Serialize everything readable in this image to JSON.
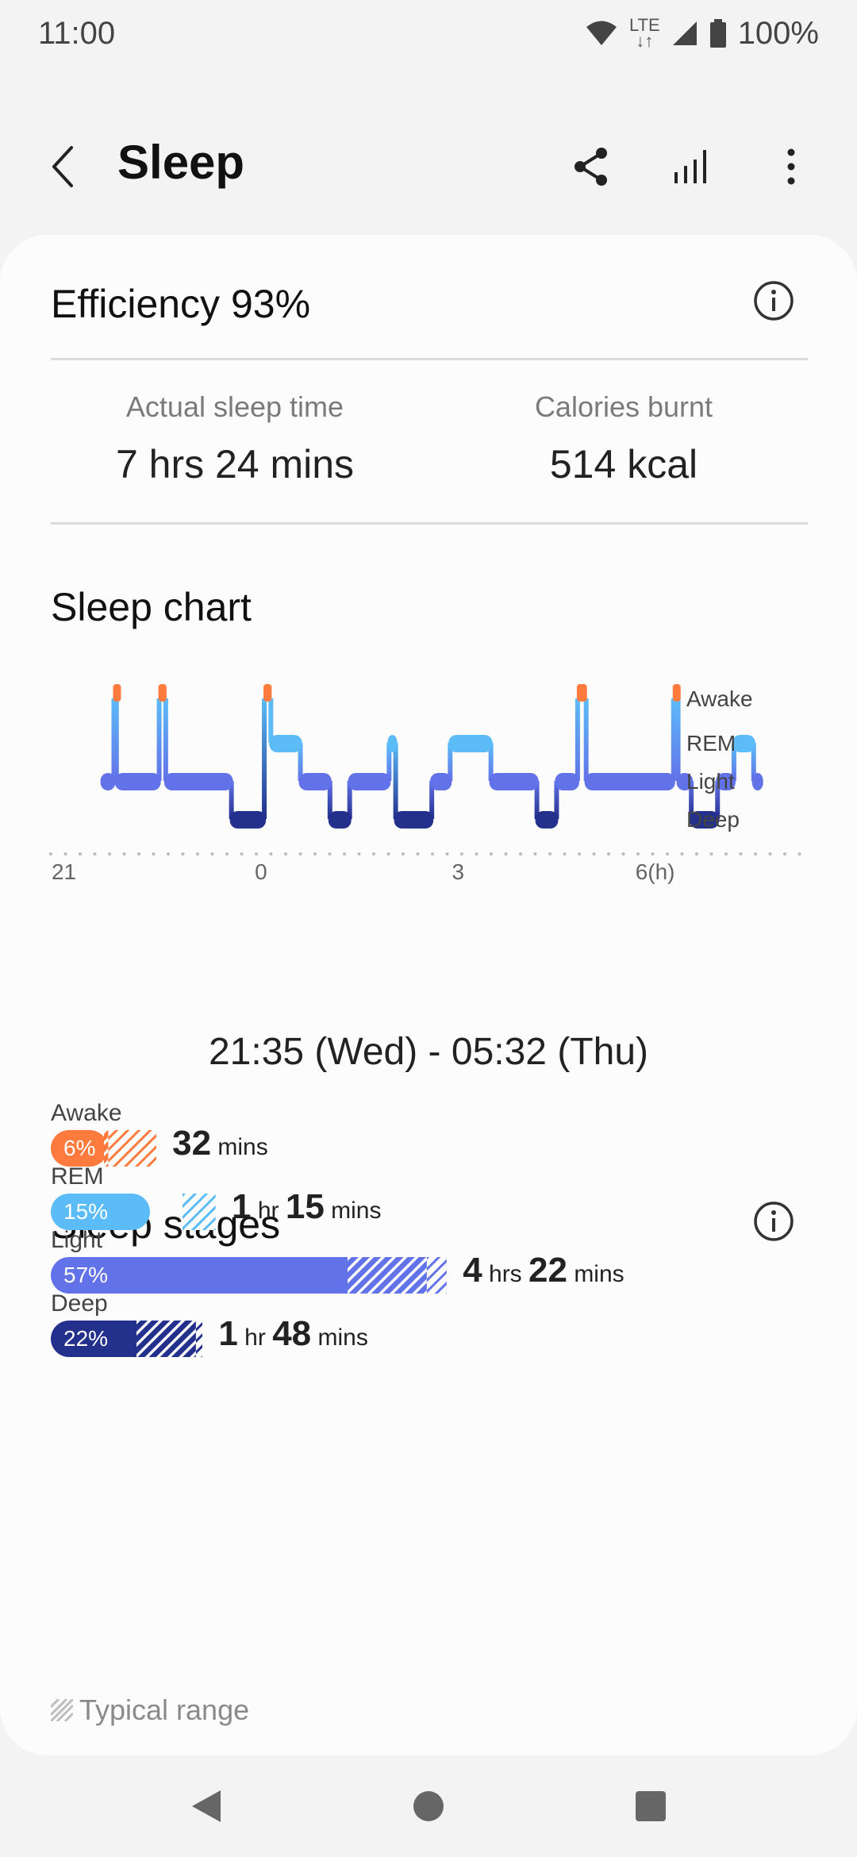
{
  "status_bar": {
    "time": "11:00",
    "network": "LTE",
    "battery": "100%"
  },
  "app_bar": {
    "title": "Sleep",
    "icons": [
      "back-icon",
      "share-icon",
      "bar-chart-icon",
      "more-vert-icon"
    ]
  },
  "efficiency": {
    "text": "Efficiency 93%"
  },
  "stats": [
    {
      "label": "Actual sleep time",
      "value": "7 hrs 24 mins"
    },
    {
      "label": "Calories burnt",
      "value": "514 kcal"
    }
  ],
  "sleep_chart": {
    "title": "Sleep chart",
    "range": "21:35 (Wed) - 05:32 (Thu)"
  },
  "chart_data": {
    "type": "line",
    "title": "Sleep chart",
    "y_categories": [
      "Awake",
      "REM",
      "Light",
      "Deep"
    ],
    "x_tick_labels": [
      "21",
      "0",
      "3",
      "6(h)"
    ],
    "x_ticks": [
      21,
      24,
      27,
      30
    ],
    "xlim": [
      20.8,
      32.3
    ],
    "segments": [
      {
        "start": 21.58,
        "end": 21.76,
        "stage": "Light"
      },
      {
        "start": 21.76,
        "end": 21.8,
        "stage": "Awake"
      },
      {
        "start": 21.8,
        "end": 22.45,
        "stage": "Light"
      },
      {
        "start": 22.45,
        "end": 22.55,
        "stage": "Awake"
      },
      {
        "start": 22.55,
        "end": 23.55,
        "stage": "Light"
      },
      {
        "start": 23.55,
        "end": 24.05,
        "stage": "Deep"
      },
      {
        "start": 24.05,
        "end": 24.15,
        "stage": "Awake"
      },
      {
        "start": 24.15,
        "end": 24.6,
        "stage": "REM"
      },
      {
        "start": 24.6,
        "end": 25.05,
        "stage": "Light"
      },
      {
        "start": 25.05,
        "end": 25.35,
        "stage": "Deep"
      },
      {
        "start": 25.35,
        "end": 25.95,
        "stage": "Light"
      },
      {
        "start": 25.95,
        "end": 26.05,
        "stage": "REM"
      },
      {
        "start": 26.05,
        "end": 26.6,
        "stage": "Deep"
      },
      {
        "start": 26.6,
        "end": 26.88,
        "stage": "Light"
      },
      {
        "start": 26.88,
        "end": 27.5,
        "stage": "REM"
      },
      {
        "start": 27.5,
        "end": 28.2,
        "stage": "Light"
      },
      {
        "start": 28.2,
        "end": 28.5,
        "stage": "Deep"
      },
      {
        "start": 28.5,
        "end": 28.82,
        "stage": "Light"
      },
      {
        "start": 28.82,
        "end": 28.95,
        "stage": "Awake"
      },
      {
        "start": 28.95,
        "end": 30.28,
        "stage": "Light"
      },
      {
        "start": 30.28,
        "end": 30.35,
        "stage": "Awake"
      },
      {
        "start": 30.35,
        "end": 30.55,
        "stage": "Light"
      },
      {
        "start": 30.55,
        "end": 30.95,
        "stage": "Deep"
      },
      {
        "start": 30.95,
        "end": 31.2,
        "stage": "Light"
      },
      {
        "start": 31.2,
        "end": 31.5,
        "stage": "REM"
      },
      {
        "start": 31.5,
        "end": 31.62,
        "stage": "Light"
      }
    ],
    "grid": false,
    "legend": "none"
  },
  "sleep_stages": {
    "title": "Sleep stages",
    "stages": [
      {
        "name": "Awake",
        "percent": "6%",
        "time_parts": [
          "32",
          " mins"
        ],
        "color": "#ff7a3d",
        "fraction": 0.06,
        "typical_range": [
          0.08,
          0.16
        ]
      },
      {
        "name": "REM",
        "percent": "15%",
        "time_parts": [
          "1",
          " hr ",
          "15",
          " mins"
        ],
        "color": "#5cbcf8",
        "fraction": 0.15,
        "typical_range": [
          0.2,
          0.25
        ]
      },
      {
        "name": "Light",
        "percent": "57%",
        "time_parts": [
          "4",
          " hrs ",
          "22",
          " mins"
        ],
        "color": "#6272e8",
        "fraction": 0.57,
        "typical_range": [
          0.45,
          0.6
        ]
      },
      {
        "name": "Deep",
        "percent": "22%",
        "time_parts": [
          "1",
          " hr ",
          "48",
          " mins"
        ],
        "color": "#23308c",
        "fraction": 0.22,
        "typical_range": [
          0.13,
          0.23
        ]
      }
    ],
    "legend_label": "Typical range"
  },
  "colors": {
    "awake": "#ff7a3d",
    "rem": "#5cbcf8",
    "light": "#6272e8",
    "deep": "#23308c"
  }
}
